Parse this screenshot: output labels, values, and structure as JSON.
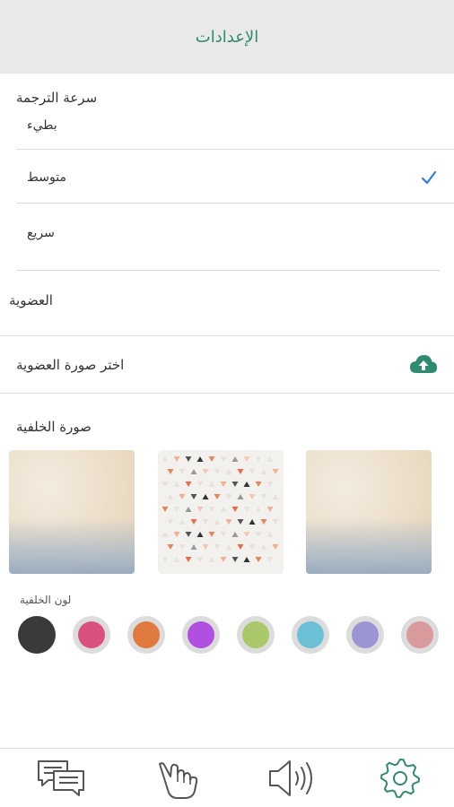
{
  "header": {
    "title": "الإعدادات"
  },
  "translation_speed": {
    "label": "سرعة الترجمة",
    "options": [
      {
        "label": "بطيء",
        "selected": false
      },
      {
        "label": "متوسط",
        "selected": true
      },
      {
        "label": "سريع",
        "selected": false
      }
    ]
  },
  "membership": {
    "label": "العضوية",
    "choose_avatar_label": "اختر صورة العضوية",
    "upload_icon": "cloud-upload-icon"
  },
  "background_image": {
    "label": "صورة الخلفية",
    "thumbnails": [
      "watercolor",
      "triangle-pattern",
      "watercolor"
    ]
  },
  "background_color": {
    "label": "لون الخلفية",
    "swatches": [
      "#3a3a3a",
      "#d9517f",
      "#e07a3e",
      "#b14fe0",
      "#a9c86a",
      "#6cc0d6",
      "#9b95d4",
      "#d89a9a"
    ]
  },
  "nav": {
    "items": [
      "chat-icon",
      "sign-hand-icon",
      "speaker-icon",
      "settings-gear-icon"
    ],
    "active_color": "#2e8b6f"
  },
  "accent": {
    "check_color": "#2f7fe0"
  }
}
